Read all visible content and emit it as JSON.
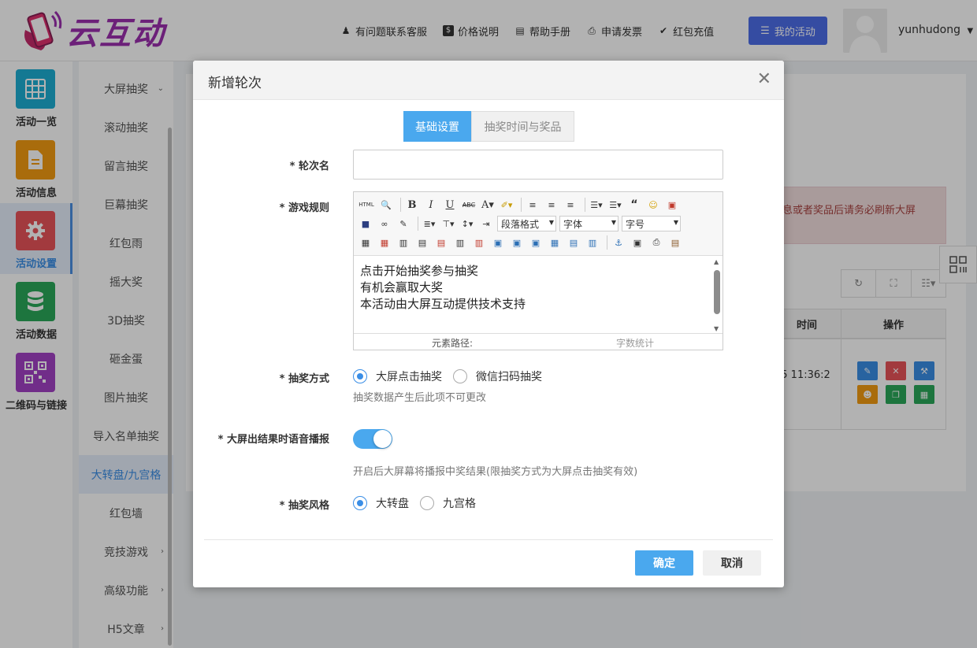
{
  "brand": {
    "name": "云互动"
  },
  "topnav": [
    {
      "label": "有问题联系客服",
      "icon": "user-plus-icon"
    },
    {
      "label": "价格说明",
      "icon": "dollar-icon"
    },
    {
      "label": "帮助手册",
      "icon": "book-icon"
    },
    {
      "label": "申请发票",
      "icon": "printer-icon"
    },
    {
      "label": "红包充值",
      "icon": "shield-check-icon"
    }
  ],
  "my_activity": "我的活动",
  "username": "yunhudong",
  "rail": [
    {
      "label": "活动一览",
      "icon": "grid-icon",
      "color": "#1eaed3"
    },
    {
      "label": "活动信息",
      "icon": "document-icon",
      "color": "#f39b12"
    },
    {
      "label": "活动设置",
      "icon": "gear-icon",
      "color": "#e9535a"
    },
    {
      "label": "活动数据",
      "icon": "database-icon",
      "color": "#2aa85a"
    },
    {
      "label": "二维码与链接",
      "icon": "qrcode-icon",
      "color": "#a241c5"
    }
  ],
  "submenu": [
    {
      "label": "大屏抽奖",
      "chev": "⌄"
    },
    {
      "label": "滚动抽奖"
    },
    {
      "label": "留言抽奖"
    },
    {
      "label": "巨幕抽奖"
    },
    {
      "label": "红包雨"
    },
    {
      "label": "摇大奖"
    },
    {
      "label": "3D抽奖"
    },
    {
      "label": "砸金蛋"
    },
    {
      "label": "图片抽奖"
    },
    {
      "label": "导入名单抽奖"
    },
    {
      "label": "大转盘/九宫格"
    },
    {
      "label": "红包墙"
    },
    {
      "label": "竞技游戏",
      "chev": "›"
    },
    {
      "label": "高级功能",
      "chev": "›"
    },
    {
      "label": "H5文章",
      "chev": "›"
    }
  ],
  "background": {
    "alert": "息或者奖品后请务必刷新大屏",
    "th_time": "时间",
    "th_ops": "操作",
    "td_time": "25 11:36:2"
  },
  "modal": {
    "title": "新增轮次",
    "tabs": [
      "基础设置",
      "抽奖时间与奖品"
    ],
    "round_name_label": "* 轮次名",
    "rules_label": "* 游戏规则",
    "rules_lines": [
      "点击开始抽奖参与抽奖",
      "有机会赢取大奖",
      "本活动由大屏互动提供技术支持"
    ],
    "editor_toolbar": {
      "html": "HTML",
      "para": "段落格式",
      "font": "字体",
      "size": "字号"
    },
    "editor_path": "元素路径:",
    "editor_count": "字数统计",
    "mode_label": "* 抽奖方式",
    "mode_options": [
      "大屏点击抽奖",
      "微信扫码抽奖"
    ],
    "mode_hint": "抽奖数据产生后此项不可更改",
    "voice_label": "* 大屏出结果时语音播报",
    "voice_hint": "开启后大屏幕将播报中奖结果(限抽奖方式为大屏点击抽奖有效)",
    "style_label": "* 抽奖风格",
    "style_options": [
      "大转盘",
      "九宫格"
    ],
    "ok": "确定",
    "cancel": "取消"
  }
}
